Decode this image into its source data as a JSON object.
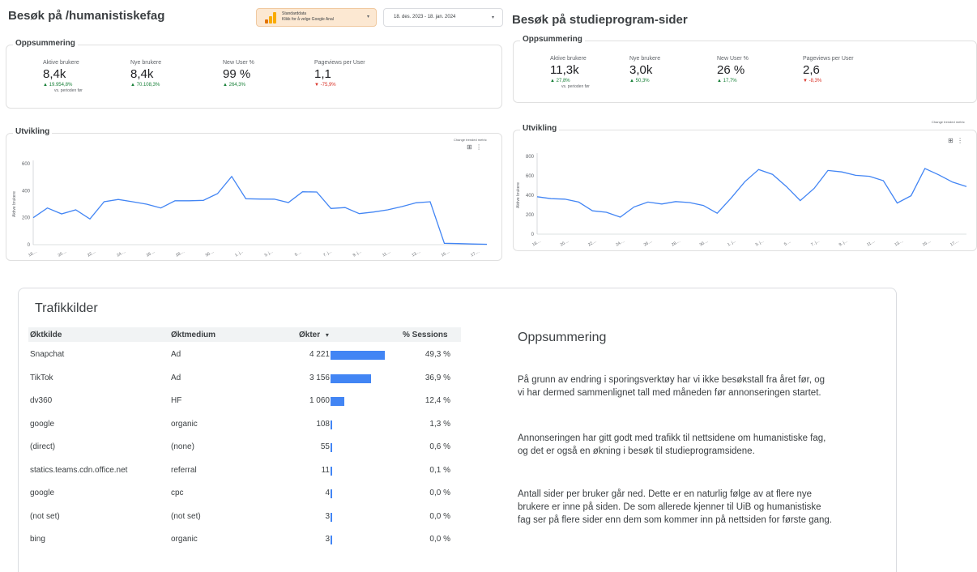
{
  "left": {
    "title": "Besøk på /humanistiskefag",
    "summary_label": "Oppsummering",
    "metrics": [
      {
        "label": "Aktive brukere",
        "value": "8,4k",
        "delta": "▲ 19.954,8%",
        "sub": "vs. perioden før",
        "dir": "up"
      },
      {
        "label": "Nye brukere",
        "value": "8,4k",
        "delta": "▲ 70.108,3%",
        "dir": "up"
      },
      {
        "label": "New User %",
        "value": "99 %",
        "delta": "▲ 264,3%",
        "dir": "up"
      },
      {
        "label": "Pageviews per User",
        "value": "1,1",
        "delta": "▼ -75,9%",
        "dir": "down"
      }
    ],
    "trend_label": "Utvikling",
    "change_metric": "Change trended metric",
    "chart_data": {
      "type": "line",
      "ylabel": "Aktive brukere",
      "ylim": [
        0,
        600
      ],
      "yticks": [
        "0",
        "200",
        "400",
        "600"
      ],
      "xticks": [
        "18....",
        "20....",
        "22....",
        "24....",
        "26....",
        "28....",
        "30....",
        "1. j...",
        "3. j...",
        "5....",
        "7. j...",
        "9. j...",
        "11....",
        "13....",
        "15....",
        "17...."
      ],
      "values": [
        200,
        272,
        228,
        258,
        190,
        318,
        335,
        318,
        300,
        272,
        325,
        325,
        328,
        378,
        505,
        340,
        338,
        337,
        312,
        392,
        390,
        268,
        275,
        230,
        242,
        258,
        282,
        310,
        318,
        10,
        8,
        5,
        3
      ],
      "color": "#4285f4"
    }
  },
  "ga_chip": {
    "line1": "Standarddata",
    "line2": "Klikk for å velge Google Anal",
    "arrow": "▾"
  },
  "date_chip": {
    "text": "18. des. 2023 - 18. jan. 2024",
    "arrow": "▾"
  },
  "right": {
    "title": "Besøk på studieprogram-sider",
    "summary_label": "Oppsummering",
    "metrics": [
      {
        "label": "Aktive brukere",
        "value": "11,3k",
        "delta": "▲ 27,8%",
        "sub": "vs. perioden før",
        "dir": "up"
      },
      {
        "label": "Nye brukere",
        "value": "3,0k",
        "delta": "▲ 50,3%",
        "dir": "up"
      },
      {
        "label": "New User %",
        "value": "26 %",
        "delta": "▲ 17,7%",
        "dir": "up"
      },
      {
        "label": "Pageviews per User",
        "value": "2,6",
        "delta": "▼ -8,3%",
        "dir": "down"
      }
    ],
    "trend_label": "Utvikling",
    "change_metric": "Change trended metric",
    "chart_data": {
      "type": "line",
      "ylabel": "Aktive brukere",
      "ylim": [
        0,
        800
      ],
      "yticks": [
        "0",
        "200",
        "400",
        "600",
        "800"
      ],
      "xticks": [
        "18....",
        "20....",
        "22....",
        "24....",
        "26....",
        "28....",
        "30....",
        "1. j...",
        "3. j...",
        "5....",
        "7. j...",
        "9. j...",
        "11....",
        "13....",
        "15....",
        "17...."
      ],
      "values": [
        385,
        365,
        360,
        330,
        240,
        225,
        175,
        280,
        330,
        310,
        335,
        325,
        295,
        215,
        370,
        540,
        665,
        615,
        490,
        345,
        470,
        655,
        640,
        605,
        595,
        550,
        320,
        395,
        675,
        610,
        535,
        490
      ],
      "color": "#4285f4"
    }
  },
  "traffic": {
    "title": "Trafikkilder",
    "headers": [
      "Øktkilde",
      "Øktmedium",
      "Økter",
      "% Sessions"
    ],
    "sort_icon": "▾",
    "max": 4221,
    "rows": [
      {
        "source": "Snapchat",
        "medium": "Ad",
        "sessions": "4 221",
        "value": 4221,
        "pct": "49,3 %"
      },
      {
        "source": "TikTok",
        "medium": "Ad",
        "sessions": "3 156",
        "value": 3156,
        "pct": "36,9 %"
      },
      {
        "source": "dv360",
        "medium": "HF",
        "sessions": "1 060",
        "value": 1060,
        "pct": "12,4 %"
      },
      {
        "source": "google",
        "medium": "organic",
        "sessions": "108",
        "value": 108,
        "pct": "1,3 %"
      },
      {
        "source": "(direct)",
        "medium": "(none)",
        "sessions": "55",
        "value": 55,
        "pct": "0,6 %"
      },
      {
        "source": "statics.teams.cdn.office.net",
        "medium": "referral",
        "sessions": "11",
        "value": 11,
        "pct": "0,1 %"
      },
      {
        "source": "google",
        "medium": "cpc",
        "sessions": "4",
        "value": 4,
        "pct": "0,0 %"
      },
      {
        "source": "(not set)",
        "medium": "(not set)",
        "sessions": "3",
        "value": 3,
        "pct": "0,0 %"
      },
      {
        "source": "bing",
        "medium": "organic",
        "sessions": "3",
        "value": 3,
        "pct": "0,0 %"
      }
    ]
  },
  "oppsummering": {
    "title": "Oppsummering",
    "p1": "På grunn av endring i sporingsverktøy har vi ikke besøkstall fra året før, og vi har dermed sammenlignet tall med måneden før annonseringen startet.",
    "p2": "Annonseringen har gitt godt med trafikk til nettsidene om humanistiske fag, og det er også en økning i besøk til studieprogramsidene.",
    "p3": "Antall sider per bruker går ned. Dette er en naturlig følge av at flere nye brukere er inne på siden. De som allerede kjenner til UiB og humanistiske fag ser på flere sider enn dem som kommer inn på nettsiden for første gang."
  }
}
